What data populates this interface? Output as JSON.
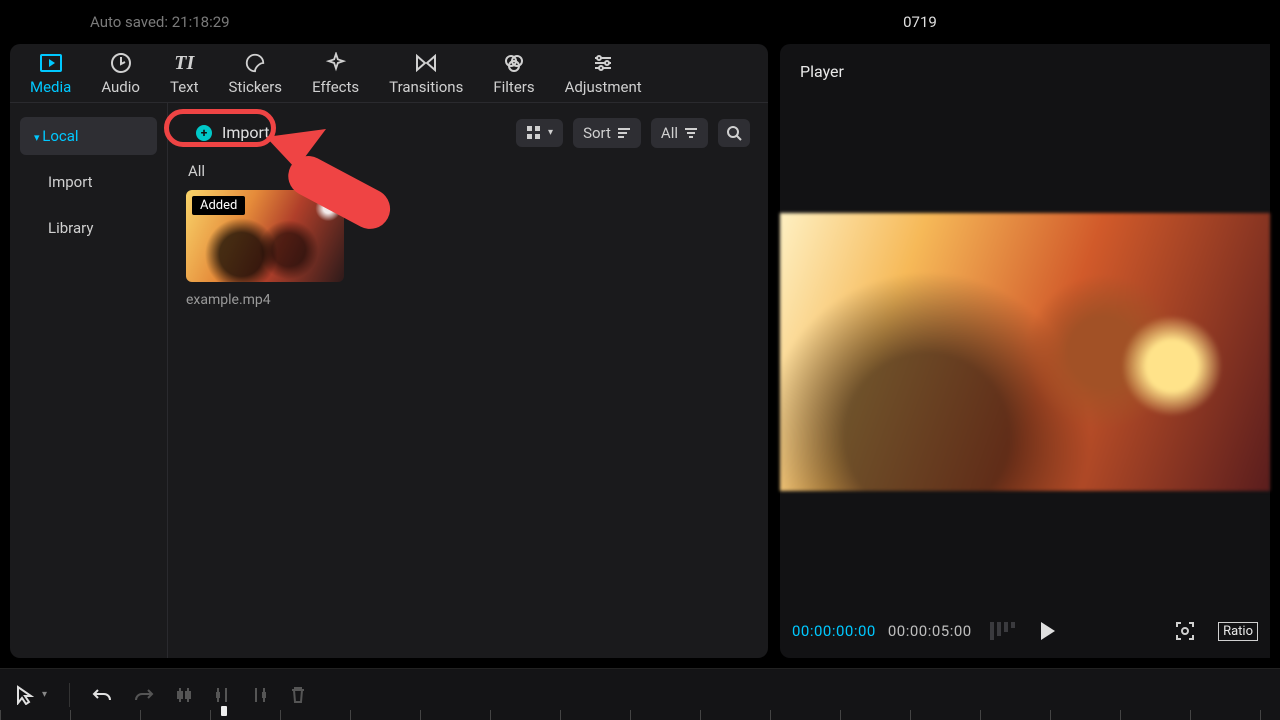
{
  "status": {
    "autosave": "Auto saved: 21:18:29",
    "project_title": "0719"
  },
  "tabs": {
    "media": "Media",
    "audio": "Audio",
    "text": "Text",
    "stickers": "Stickers",
    "effects": "Effects",
    "transitions": "Transitions",
    "filters": "Filters",
    "adjustment": "Adjustment"
  },
  "sidebar": {
    "local": "Local",
    "import": "Import",
    "library": "Library"
  },
  "media": {
    "import_button": "Import",
    "all_header": "All",
    "sort_label": "Sort",
    "filter_all": "All",
    "clip": {
      "badge": "Added",
      "filename": "example.mp4"
    }
  },
  "player": {
    "title": "Player",
    "current_tc": "00:00:00:00",
    "duration_tc": "00:00:05:00",
    "ratio_label": "Ratio"
  }
}
